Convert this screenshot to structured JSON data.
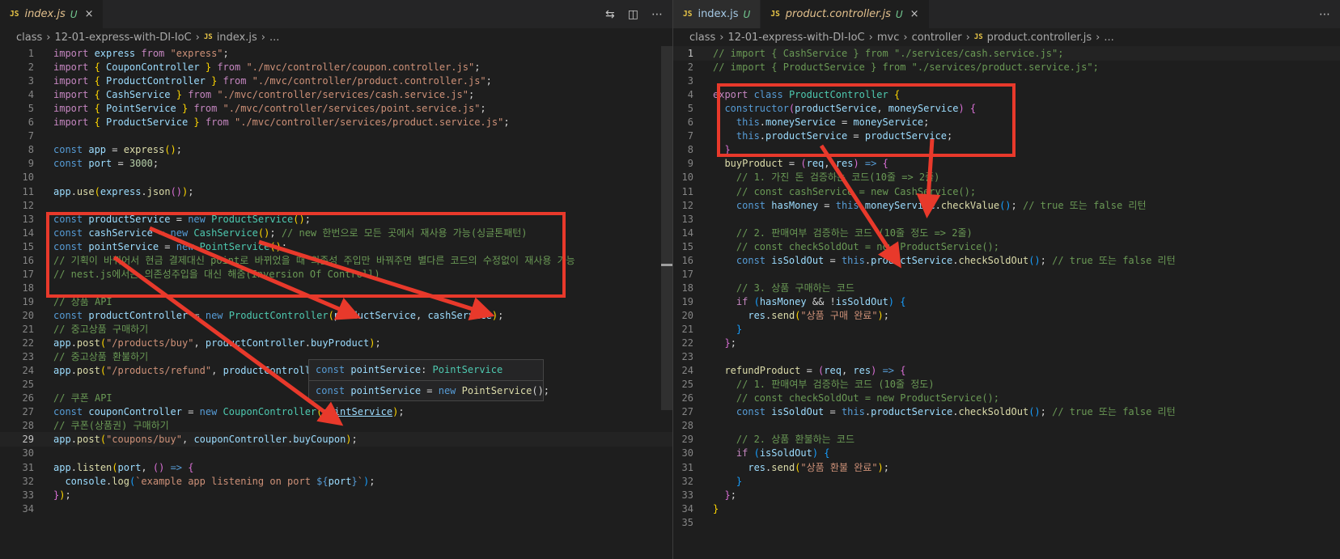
{
  "left": {
    "tabs": [
      {
        "badge": "JS",
        "name": "index.js",
        "status": "U",
        "close": "×"
      }
    ],
    "actions": [
      "⇆",
      "◫",
      "⋯"
    ],
    "breadcrumb": [
      "class",
      "12-01-express-with-DI-IoC",
      "index.js",
      "..."
    ],
    "breadcrumb_badge": "JS",
    "current_line": 29,
    "lines": [
      [
        [
          "import ",
          "kw"
        ],
        [
          "express ",
          "vr"
        ],
        [
          "from ",
          "kw"
        ],
        [
          "\"express\"",
          "st"
        ],
        [
          ";",
          "pn"
        ]
      ],
      [
        [
          "import ",
          "kw"
        ],
        [
          "{ ",
          "b1"
        ],
        [
          "CouponController ",
          "vr"
        ],
        [
          "} ",
          "b1"
        ],
        [
          "from ",
          "kw"
        ],
        [
          "\"./mvc/controller/coupon.controller.js\"",
          "st"
        ],
        [
          ";",
          "pn"
        ]
      ],
      [
        [
          "import ",
          "kw"
        ],
        [
          "{ ",
          "b1"
        ],
        [
          "ProductController ",
          "vr"
        ],
        [
          "} ",
          "b1"
        ],
        [
          "from ",
          "kw"
        ],
        [
          "\"./mvc/controller/product.controller.js\"",
          "st"
        ],
        [
          ";",
          "pn"
        ]
      ],
      [
        [
          "import ",
          "kw"
        ],
        [
          "{ ",
          "b1"
        ],
        [
          "CashService ",
          "vr"
        ],
        [
          "} ",
          "b1"
        ],
        [
          "from ",
          "kw"
        ],
        [
          "\"./mvc/controller/services/cash.service.js\"",
          "st"
        ],
        [
          ";",
          "pn"
        ]
      ],
      [
        [
          "import ",
          "kw"
        ],
        [
          "{ ",
          "b1"
        ],
        [
          "PointService ",
          "vr"
        ],
        [
          "} ",
          "b1"
        ],
        [
          "from ",
          "kw"
        ],
        [
          "\"./mvc/controller/services/point.service.js\"",
          "st"
        ],
        [
          ";",
          "pn"
        ]
      ],
      [
        [
          "import ",
          "kw"
        ],
        [
          "{ ",
          "b1"
        ],
        [
          "ProductService ",
          "vr"
        ],
        [
          "} ",
          "b1"
        ],
        [
          "from ",
          "kw"
        ],
        [
          "\"./mvc/controller/services/product.service.js\"",
          "st"
        ],
        [
          ";",
          "pn"
        ]
      ],
      [],
      [
        [
          "const ",
          "sk"
        ],
        [
          "app ",
          "vr"
        ],
        [
          "= ",
          "pn"
        ],
        [
          "express",
          "fn"
        ],
        [
          "()",
          "b1"
        ],
        [
          ";",
          "pn"
        ]
      ],
      [
        [
          "const ",
          "sk"
        ],
        [
          "port ",
          "vr"
        ],
        [
          "= ",
          "pn"
        ],
        [
          "3000",
          "nm"
        ],
        [
          ";",
          "pn"
        ]
      ],
      [],
      [
        [
          "app",
          "vr"
        ],
        [
          ".",
          "pn"
        ],
        [
          "use",
          "fn"
        ],
        [
          "(",
          "b1"
        ],
        [
          "express",
          "vr"
        ],
        [
          ".",
          "pn"
        ],
        [
          "json",
          "fn"
        ],
        [
          "()",
          "b2"
        ],
        [
          ")",
          "b1"
        ],
        [
          ";",
          "pn"
        ]
      ],
      [],
      [
        [
          "const ",
          "sk"
        ],
        [
          "productService ",
          "vr"
        ],
        [
          "= ",
          "pn"
        ],
        [
          "new ",
          "sk"
        ],
        [
          "ProductService",
          "cl"
        ],
        [
          "()",
          "b1"
        ],
        [
          ";",
          "pn"
        ]
      ],
      [
        [
          "const ",
          "sk"
        ],
        [
          "cashService ",
          "vr"
        ],
        [
          "= ",
          "pn"
        ],
        [
          "new ",
          "sk"
        ],
        [
          "CashService",
          "cl"
        ],
        [
          "()",
          "b1"
        ],
        [
          "; ",
          "pn"
        ],
        [
          "// new 한번으로 모든 곳에서 재사용 가능(싱글톤패턴)",
          "cm"
        ]
      ],
      [
        [
          "const ",
          "sk"
        ],
        [
          "pointService ",
          "vr"
        ],
        [
          "= ",
          "pn"
        ],
        [
          "new ",
          "sk"
        ],
        [
          "PointService",
          "cl"
        ],
        [
          "()",
          "b1"
        ],
        [
          ";",
          "pn"
        ]
      ],
      [
        [
          "// 기획이 바뀌어서 현금 결제대신 point로 바뀌었을 때 의존성 주입만 바꿔주면 별다른 코드의 수정없이 재사용 가능",
          "cm"
        ]
      ],
      [
        [
          "// nest.js에서는 의존성주입을 대신 해줌(Inversion Of Controll)",
          "cm"
        ]
      ],
      [],
      [
        [
          "// 상품 API",
          "cm"
        ]
      ],
      [
        [
          "const ",
          "sk"
        ],
        [
          "productController ",
          "vr"
        ],
        [
          "= ",
          "pn"
        ],
        [
          "new ",
          "sk"
        ],
        [
          "ProductController",
          "cl"
        ],
        [
          "(",
          "b1"
        ],
        [
          "productService",
          "vr"
        ],
        [
          ", ",
          "pn"
        ],
        [
          "cashService",
          "vr"
        ],
        [
          ")",
          "b1"
        ],
        [
          ";",
          "pn"
        ]
      ],
      [
        [
          "// 중고상품 구매하기",
          "cm"
        ]
      ],
      [
        [
          "app",
          "vr"
        ],
        [
          ".",
          "pn"
        ],
        [
          "post",
          "fn"
        ],
        [
          "(",
          "b1"
        ],
        [
          "\"/products/buy\"",
          "st"
        ],
        [
          ", ",
          "pn"
        ],
        [
          "productController",
          "vr"
        ],
        [
          ".",
          "pn"
        ],
        [
          "buyProduct",
          "vr"
        ],
        [
          ")",
          "b1"
        ],
        [
          ";",
          "pn"
        ]
      ],
      [
        [
          "// 중고상품 환불하기",
          "cm"
        ]
      ],
      [
        [
          "app",
          "vr"
        ],
        [
          ".",
          "pn"
        ],
        [
          "post",
          "fn"
        ],
        [
          "(",
          "b1"
        ],
        [
          "\"/products/refund\"",
          "st"
        ],
        [
          ", ",
          "pn"
        ],
        [
          "productController",
          "vr"
        ]
      ],
      [],
      [
        [
          "// 쿠폰 API",
          "cm"
        ]
      ],
      [
        [
          "const ",
          "sk"
        ],
        [
          "couponController ",
          "vr"
        ],
        [
          "= ",
          "pn"
        ],
        [
          "new ",
          "sk"
        ],
        [
          "CouponController",
          "cl"
        ],
        [
          "(",
          "b1"
        ],
        [
          "pointService",
          "vr link"
        ],
        [
          ")",
          "b1"
        ],
        [
          ";",
          "pn"
        ]
      ],
      [
        [
          "// 쿠폰(상품권) 구매하기",
          "cm"
        ]
      ],
      [
        [
          "app",
          "vr"
        ],
        [
          ".",
          "pn"
        ],
        [
          "post",
          "fn"
        ],
        [
          "(",
          "b1"
        ],
        [
          "\"coupons/buy\"",
          "st"
        ],
        [
          ", ",
          "pn"
        ],
        [
          "couponController",
          "vr"
        ],
        [
          ".",
          "pn"
        ],
        [
          "buyCoupon",
          "vr"
        ],
        [
          ")",
          "b1"
        ],
        [
          ";",
          "pn"
        ]
      ],
      [],
      [
        [
          "app",
          "vr"
        ],
        [
          ".",
          "pn"
        ],
        [
          "listen",
          "fn"
        ],
        [
          "(",
          "b1"
        ],
        [
          "port",
          "vr"
        ],
        [
          ", ",
          "pn"
        ],
        [
          "() ",
          "b2"
        ],
        [
          "=> ",
          "sk"
        ],
        [
          "{",
          "b2"
        ]
      ],
      [
        [
          "  console",
          "vr"
        ],
        [
          ".",
          "pn"
        ],
        [
          "log",
          "fn"
        ],
        [
          "(",
          "b3"
        ],
        [
          "`example app listening on port ",
          "st"
        ],
        [
          "${",
          "sk"
        ],
        [
          "port",
          "vr"
        ],
        [
          "}",
          "sk"
        ],
        [
          "`",
          "st"
        ],
        [
          ")",
          "b3"
        ],
        [
          ";",
          "pn"
        ]
      ],
      [
        [
          "}",
          "b2"
        ],
        [
          ")",
          "b1"
        ],
        [
          ";",
          "pn"
        ]
      ],
      []
    ],
    "hover": [
      [
        [
          "const ",
          "sk"
        ],
        [
          "pointService",
          "vr"
        ],
        [
          ": ",
          "pn"
        ],
        [
          "PointService",
          "cl"
        ]
      ],
      [
        [
          "const ",
          "sk"
        ],
        [
          "pointService ",
          "vr"
        ],
        [
          "= ",
          "pn"
        ],
        [
          "new ",
          "sk"
        ],
        [
          "PointService",
          "fn"
        ],
        [
          "();",
          "pn"
        ]
      ]
    ]
  },
  "right": {
    "tabs": [
      {
        "badge": "JS",
        "name": "index.js",
        "status": "U",
        "close": ""
      },
      {
        "badge": "JS",
        "name": "product.controller.js",
        "status": "U",
        "close": "×"
      }
    ],
    "actions": [
      "⋯"
    ],
    "breadcrumb": [
      "class",
      "12-01-express-with-DI-IoC",
      "mvc",
      "controller",
      "product.controller.js",
      "..."
    ],
    "breadcrumb_badge": "JS",
    "current_line": 1,
    "lines": [
      [
        [
          "// import { CashService } from \"./services/cash.service.js\";",
          "cm"
        ]
      ],
      [
        [
          "// import { ProductService } from \"./services/product.service.js\";",
          "cm"
        ]
      ],
      [],
      [
        [
          "export ",
          "kw"
        ],
        [
          "class ",
          "sk"
        ],
        [
          "ProductController ",
          "cl"
        ],
        [
          "{",
          "b1"
        ]
      ],
      [
        [
          "  constructor",
          "sk"
        ],
        [
          "(",
          "b2"
        ],
        [
          "productService",
          "vr"
        ],
        [
          ", ",
          "pn"
        ],
        [
          "moneyService",
          "vr"
        ],
        [
          ") ",
          "b2"
        ],
        [
          "{",
          "b2"
        ]
      ],
      [
        [
          "    this",
          "sk"
        ],
        [
          ".",
          "pn"
        ],
        [
          "moneyService ",
          "vr"
        ],
        [
          "= ",
          "pn"
        ],
        [
          "moneyService",
          "vr"
        ],
        [
          ";",
          "pn"
        ]
      ],
      [
        [
          "    this",
          "sk"
        ],
        [
          ".",
          "pn"
        ],
        [
          "productService ",
          "vr"
        ],
        [
          "= ",
          "pn"
        ],
        [
          "productService",
          "vr"
        ],
        [
          ";",
          "pn"
        ]
      ],
      [
        [
          "  }",
          "b2"
        ]
      ],
      [
        [
          "  buyProduct ",
          "fn"
        ],
        [
          "= ",
          "pn"
        ],
        [
          "(",
          "b2"
        ],
        [
          "req",
          "vr"
        ],
        [
          ", ",
          "pn"
        ],
        [
          "res",
          "vr"
        ],
        [
          ") ",
          "b2"
        ],
        [
          "=> ",
          "sk"
        ],
        [
          "{",
          "b2"
        ]
      ],
      [
        [
          "    // 1. 가진 돈 검증하는 코드(10줄 => 2줄)",
          "cm"
        ]
      ],
      [
        [
          "    // const cashService = new CashService();",
          "cm"
        ]
      ],
      [
        [
          "    const ",
          "sk"
        ],
        [
          "hasMoney ",
          "vr"
        ],
        [
          "= ",
          "pn"
        ],
        [
          "this",
          "sk"
        ],
        [
          ".",
          "pn"
        ],
        [
          "moneyService",
          "vr"
        ],
        [
          ".",
          "pn"
        ],
        [
          "checkValue",
          "fn"
        ],
        [
          "()",
          "b3"
        ],
        [
          "; ",
          "pn"
        ],
        [
          "// true 또는 false 리턴",
          "cm"
        ]
      ],
      [],
      [
        [
          "    // 2. 판매여부 검증하는 코드 (10줄 정도 => 2줄)",
          "cm"
        ]
      ],
      [
        [
          "    // const checkSoldOut = new ProductService();",
          "cm"
        ]
      ],
      [
        [
          "    const ",
          "sk"
        ],
        [
          "isSoldOut ",
          "vr"
        ],
        [
          "= ",
          "pn"
        ],
        [
          "this",
          "sk"
        ],
        [
          ".",
          "pn"
        ],
        [
          "productService",
          "vr"
        ],
        [
          ".",
          "pn"
        ],
        [
          "checkSoldOut",
          "fn"
        ],
        [
          "()",
          "b3"
        ],
        [
          "; ",
          "pn"
        ],
        [
          "// true 또는 false 리턴",
          "cm"
        ]
      ],
      [],
      [
        [
          "    // 3. 상품 구매하는 코드",
          "cm"
        ]
      ],
      [
        [
          "    if ",
          "kw"
        ],
        [
          "(",
          "b3"
        ],
        [
          "hasMoney ",
          "vr"
        ],
        [
          "&& ",
          "pn"
        ],
        [
          "!",
          "pn"
        ],
        [
          "isSoldOut",
          "vr"
        ],
        [
          ") ",
          "b3"
        ],
        [
          "{",
          "b3"
        ]
      ],
      [
        [
          "      res",
          "vr"
        ],
        [
          ".",
          "pn"
        ],
        [
          "send",
          "fn"
        ],
        [
          "(",
          "b1"
        ],
        [
          "\"상품 구매 완료\"",
          "st"
        ],
        [
          ")",
          "b1"
        ],
        [
          ";",
          "pn"
        ]
      ],
      [
        [
          "    }",
          "b3"
        ]
      ],
      [
        [
          "  }",
          "b2"
        ],
        [
          ";",
          "pn"
        ]
      ],
      [],
      [
        [
          "  refundProduct ",
          "fn"
        ],
        [
          "= ",
          "pn"
        ],
        [
          "(",
          "b2"
        ],
        [
          "req",
          "vr"
        ],
        [
          ", ",
          "pn"
        ],
        [
          "res",
          "vr"
        ],
        [
          ") ",
          "b2"
        ],
        [
          "=> ",
          "sk"
        ],
        [
          "{",
          "b2"
        ]
      ],
      [
        [
          "    // 1. 판매여부 검증하는 코드 (10줄 정도)",
          "cm"
        ]
      ],
      [
        [
          "    // const checkSoldOut = new ProductService();",
          "cm"
        ]
      ],
      [
        [
          "    const ",
          "sk"
        ],
        [
          "isSoldOut ",
          "vr"
        ],
        [
          "= ",
          "pn"
        ],
        [
          "this",
          "sk"
        ],
        [
          ".",
          "pn"
        ],
        [
          "productService",
          "vr"
        ],
        [
          ".",
          "pn"
        ],
        [
          "checkSoldOut",
          "fn"
        ],
        [
          "()",
          "b3"
        ],
        [
          "; ",
          "pn"
        ],
        [
          "// true 또는 false 리턴",
          "cm"
        ]
      ],
      [],
      [
        [
          "    // 2. 상품 환불하는 코드",
          "cm"
        ]
      ],
      [
        [
          "    if ",
          "kw"
        ],
        [
          "(",
          "b3"
        ],
        [
          "isSoldOut",
          "vr"
        ],
        [
          ") ",
          "b3"
        ],
        [
          "{",
          "b3"
        ]
      ],
      [
        [
          "      res",
          "vr"
        ],
        [
          ".",
          "pn"
        ],
        [
          "send",
          "fn"
        ],
        [
          "(",
          "b1"
        ],
        [
          "\"상품 환불 완료\"",
          "st"
        ],
        [
          ")",
          "b1"
        ],
        [
          ";",
          "pn"
        ]
      ],
      [
        [
          "    }",
          "b3"
        ]
      ],
      [
        [
          "  }",
          "b2"
        ],
        [
          ";",
          "pn"
        ]
      ],
      [
        [
          "}",
          "b1"
        ]
      ],
      []
    ]
  },
  "annotation_color": "#e8392b"
}
